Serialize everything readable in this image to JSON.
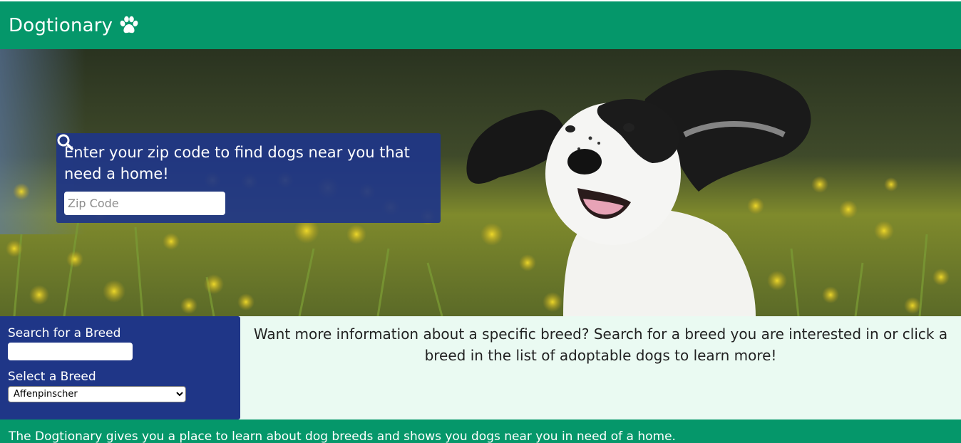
{
  "header": {
    "brand": "Dogtionary",
    "logo_icon": "paw-icon"
  },
  "hero": {
    "image": "dog-in-flower-field",
    "zip_prompt": "Enter your zip code to find dogs near you that need a home!",
    "zip_placeholder": "Zip Code",
    "zip_value": "",
    "search_icon": "search-icon"
  },
  "breed_panel": {
    "search_label": "Search for a Breed",
    "search_value": "",
    "select_label": "Select a Breed",
    "selected_breed": "Affenpinscher"
  },
  "info": {
    "text": "Want more information about a specific breed? Search for a breed you are interested in or click a breed in the list of adoptable dogs to learn more!"
  },
  "footer": {
    "text": "The Dogtionary gives you a place to learn about dog breeds and shows you dogs near you in need of a home."
  },
  "colors": {
    "brand_green": "#05976a",
    "panel_blue": "#1f3687",
    "info_bg": "#eafaf2"
  }
}
